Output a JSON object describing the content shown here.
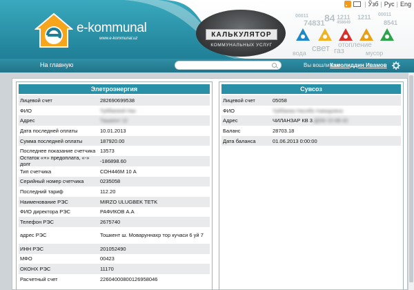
{
  "header": {
    "brand": "e-kommunal",
    "brand_url": "www.e-kommunal.uz",
    "calculator_title": "КАЛЬКУЛЯТОР",
    "calculator_subtitle": "КОММУНАЛЬНЫХ УСЛУГ",
    "languages": [
      "Ўзб",
      "Рус",
      "Eng"
    ],
    "words": {
      "voda": "вода",
      "svet": "свет",
      "gaz": "газ",
      "otoplenie": "отопление",
      "musor": "мусор"
    },
    "numbers": [
      "00011",
      "74831",
      "84",
      "1211",
      "1211",
      "458649",
      "00011",
      "8541"
    ],
    "colors": {
      "teal": "#2a90a7",
      "accent_blue": "#1f88c9",
      "accent_red": "#d8312b",
      "accent_green": "#2da44c",
      "accent_yellow": "#f0b323",
      "accent_dark": "#4a4a4a"
    }
  },
  "nav": {
    "home_label": "На главную",
    "search_placeholder": "",
    "logged_in_label": "Вы вошли как:",
    "user_name": "Камолиддин Ивамов"
  },
  "electricity": {
    "title": "Элетроэнергия",
    "rows": [
      {
        "label": "Лицевой счет",
        "value": "282690699538"
      },
      {
        "label": "ФИО",
        "value": "Туйбаевой Нас",
        "blurred": true
      },
      {
        "label": "Адрес",
        "value": "Ташкент 12",
        "blurred": true
      },
      {
        "label": "Дата последней оплаты",
        "value": "10.01.2013"
      },
      {
        "label": "Сумма последней оплаты",
        "value": "187920.00"
      },
      {
        "label": "Последнее показание счетчика",
        "value": "13573"
      },
      {
        "label": "Остаток «+» предоплата, «-» долг",
        "value": "-186898.60"
      },
      {
        "label": "Тип счетчика",
        "value": "СОН446М 10 А"
      },
      {
        "label": "Серийный номер счетчика",
        "value": "0235058"
      },
      {
        "label": "Последний тариф",
        "value": "112.20"
      },
      {
        "label": "Наименование РЭС",
        "value": "MIRZO ULUGBEK TETK"
      },
      {
        "label": "ФИО директора РЭС",
        "value": "РАФИКОВ А.А"
      },
      {
        "label": "Телефон РЭС",
        "value": "2675740"
      },
      {
        "label": "адрес РЭС",
        "value": "Тошкент ш. Моваруннахр тор кучаси 6 уй 7",
        "tall": true
      },
      {
        "label": "ИНН РЭС",
        "value": "201052490"
      },
      {
        "label": "МФО",
        "value": "00423"
      },
      {
        "label": "ОКОНХ РЭС",
        "value": "11170"
      },
      {
        "label": "Расчетный счет",
        "value": "22604000800126958046"
      }
    ]
  },
  "water": {
    "title": "Сувсоз",
    "rows": [
      {
        "label": "Лицевой счет",
        "value": "05058"
      },
      {
        "label": "ФИО",
        "value": "Туйбаева Насиба Хамидовна",
        "blurred": true
      },
      {
        "label": "Адрес",
        "value": "ЧИЛАНЗАР КВ 3",
        "blur_tail": "ДОМ 15 КВ 42"
      },
      {
        "label": "Баланс",
        "value": "28703.18"
      },
      {
        "label": "Дата баланса",
        "value": "01.06.2013 0:00:00"
      }
    ]
  }
}
